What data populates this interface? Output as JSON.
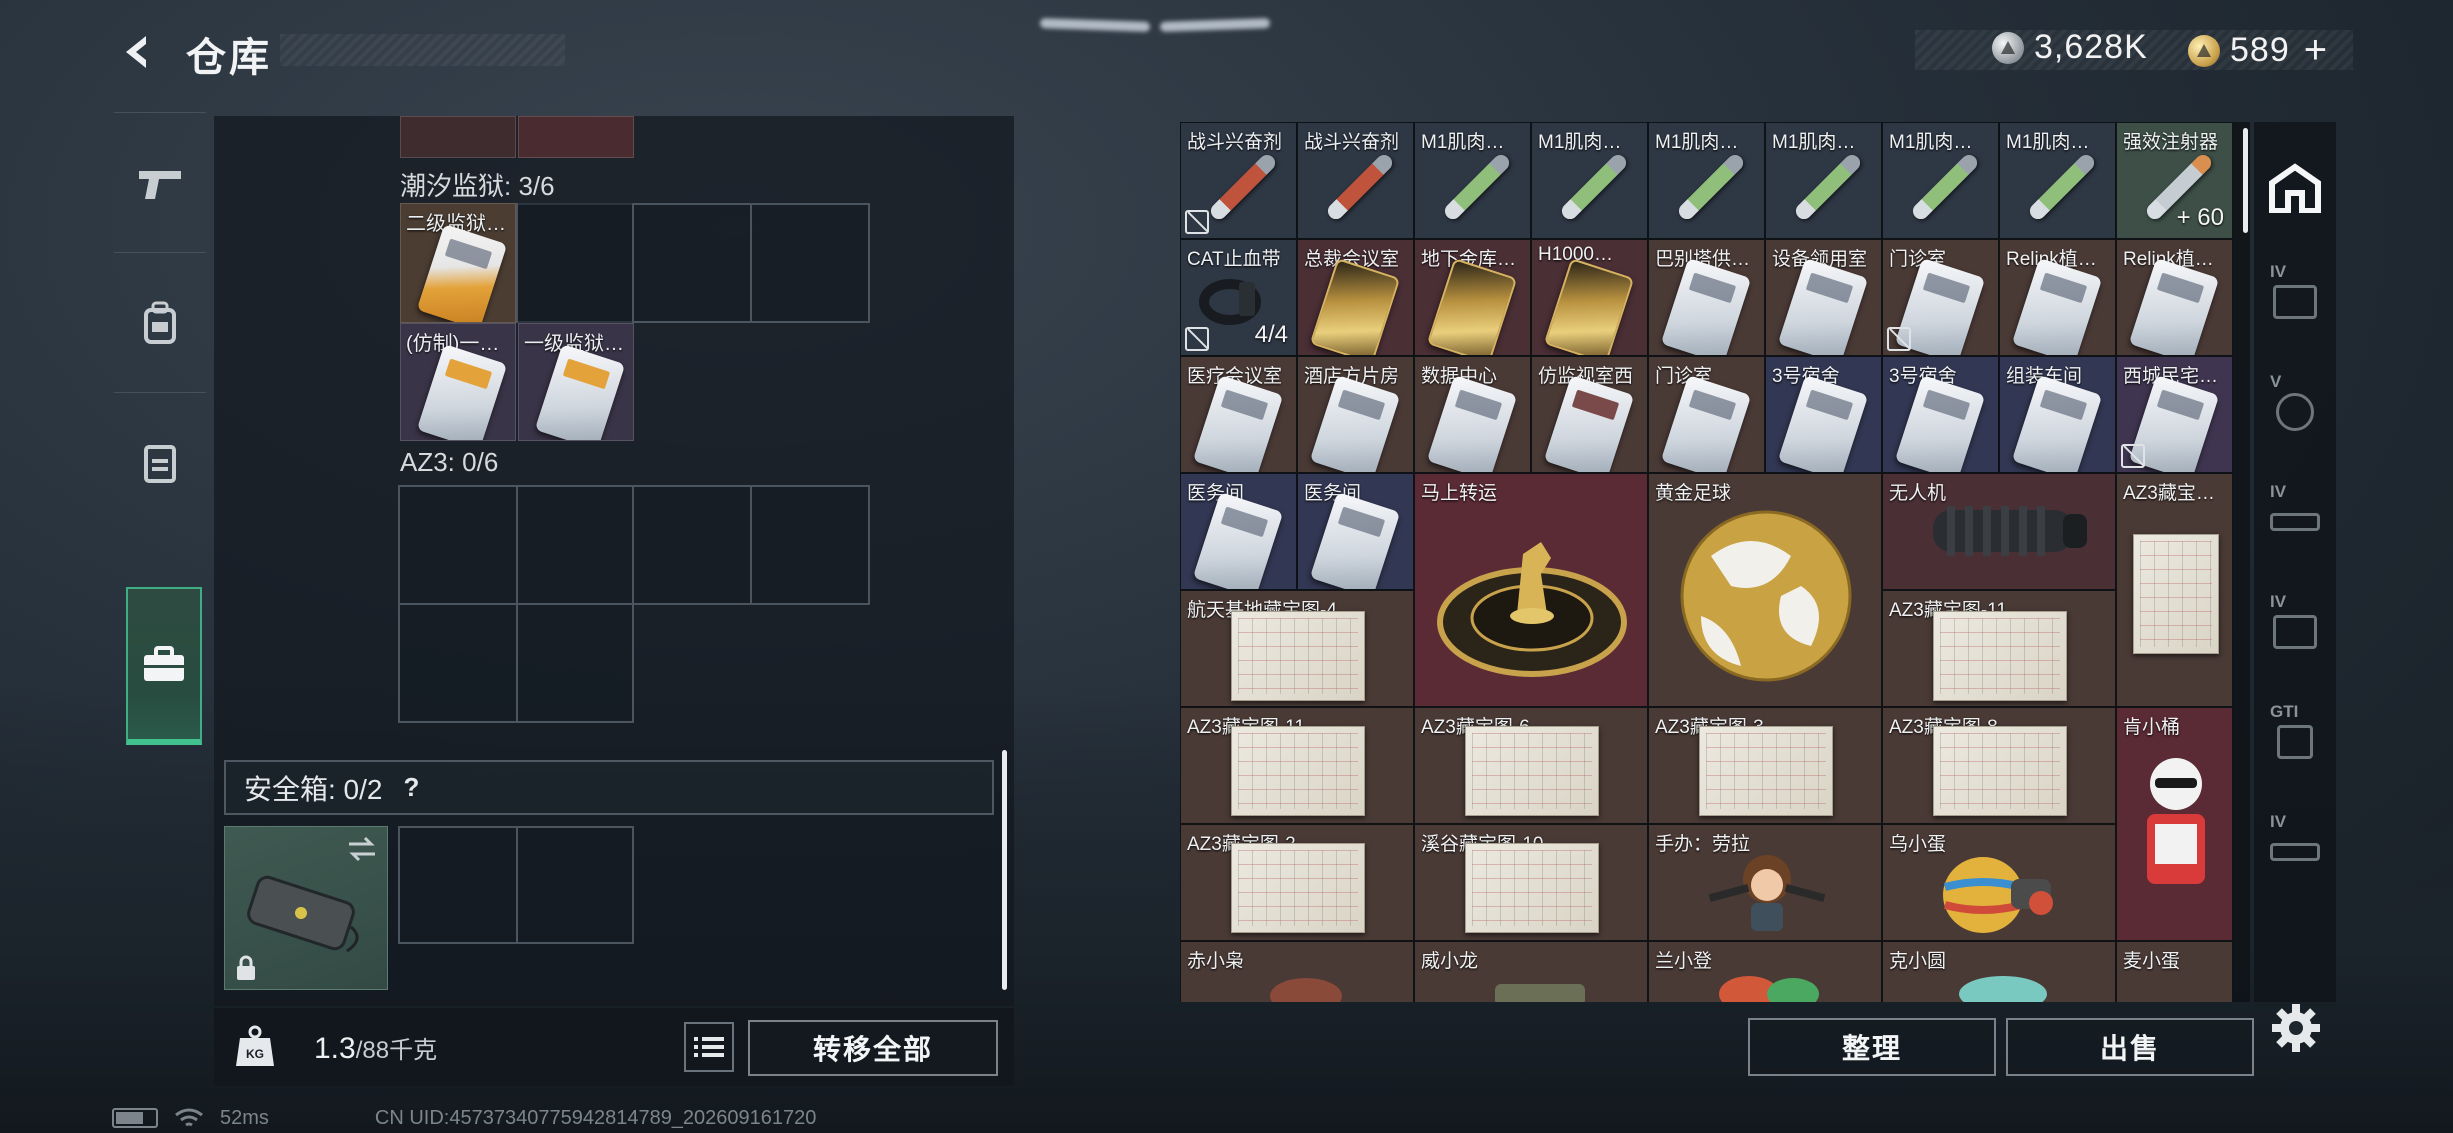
{
  "header": {
    "title": "仓库",
    "currency_silver": "3,628K",
    "currency_gold": "589",
    "add_label": "+"
  },
  "left_tabs": [
    {
      "icon": "pistol-icon"
    },
    {
      "icon": "backpack-icon"
    },
    {
      "icon": "vest-icon"
    },
    {
      "icon": "briefcase-icon",
      "active": true
    }
  ],
  "left_panel": {
    "groups": [
      {
        "label": "潮汐监狱: 3/6"
      },
      {
        "label": "AZ3: 0/6"
      }
    ],
    "items": [
      {
        "name": "二级监狱…"
      },
      {
        "name": "(仿制)一…"
      },
      {
        "name": "一级监狱…"
      }
    ],
    "safe_box": {
      "label": "安全箱: 0/2",
      "help": "?"
    },
    "weight": {
      "value": "1.3",
      "unit": "/88千克"
    },
    "transfer_all": "转移全部"
  },
  "grid_items": [
    {
      "name": "战斗兴奋剂"
    },
    {
      "name": "战斗兴奋剂"
    },
    {
      "name": "M1肌肉…"
    },
    {
      "name": "M1肌肉…"
    },
    {
      "name": "M1肌肉…"
    },
    {
      "name": "M1肌肉…"
    },
    {
      "name": "M1肌肉…"
    },
    {
      "name": "M1肌肉…"
    },
    {
      "name": "强效注射器",
      "count": "+ 60"
    },
    {
      "name": "CAT止血带",
      "count": "4/4"
    },
    {
      "name": "总裁会议室"
    },
    {
      "name": "地下金库…"
    },
    {
      "name": "H1000…"
    },
    {
      "name": "巴别塔供…"
    },
    {
      "name": "设备领用室"
    },
    {
      "name": "门诊室"
    },
    {
      "name": "Relink植…"
    },
    {
      "name": "Relink植…"
    },
    {
      "name": "医疗会议室"
    },
    {
      "name": "酒店方片房"
    },
    {
      "name": "数据中心"
    },
    {
      "name": "仿监视室西"
    },
    {
      "name": "门诊室"
    },
    {
      "name": "3号宿舍"
    },
    {
      "name": "3号宿舍"
    },
    {
      "name": "组装车间"
    },
    {
      "name": "西城民宅…"
    },
    {
      "name": "医务间"
    },
    {
      "name": "医务间"
    },
    {
      "name": "马上转运"
    },
    {
      "name": "黄金足球"
    },
    {
      "name": "无人机"
    },
    {
      "name": "AZ3藏宝…"
    },
    {
      "name": "航天基地藏宝图-4"
    },
    {
      "name": "AZ3藏宝图-11"
    },
    {
      "name": "AZ3藏宝图-11"
    },
    {
      "name": "AZ3藏宝图-6"
    },
    {
      "name": "AZ3藏宝图-3"
    },
    {
      "name": "AZ3藏宝图-8"
    },
    {
      "name": "肯小桶"
    },
    {
      "name": "AZ3藏宝图-2"
    },
    {
      "name": "溪谷藏宝图-10"
    },
    {
      "name": "手办：劳拉"
    },
    {
      "name": "乌小蛋"
    },
    {
      "name": "赤小枭"
    },
    {
      "name": "威小龙"
    },
    {
      "name": "兰小登"
    },
    {
      "name": "克小圆"
    },
    {
      "name": "麦小蛋"
    }
  ],
  "right_tabs": [
    {
      "label": "",
      "icon": "house-icon"
    },
    {
      "label": "IV",
      "icon": "folder-icon"
    },
    {
      "label": "V",
      "icon": "gear-box-icon"
    },
    {
      "label": "IV",
      "icon": "rifle-icon"
    },
    {
      "label": "IV",
      "icon": "medkit-icon"
    },
    {
      "label": "GTI",
      "icon": "device-icon"
    },
    {
      "label": "IV",
      "icon": "rifle-icon"
    }
  ],
  "actions": {
    "sort": "整理",
    "sell": "出售"
  },
  "status": {
    "ping": "52ms",
    "uid": "CN UID:457373407759428147​89_202609161720"
  },
  "colors": {
    "accent_green": "#42c28f",
    "panel_bg": "#12181e"
  }
}
